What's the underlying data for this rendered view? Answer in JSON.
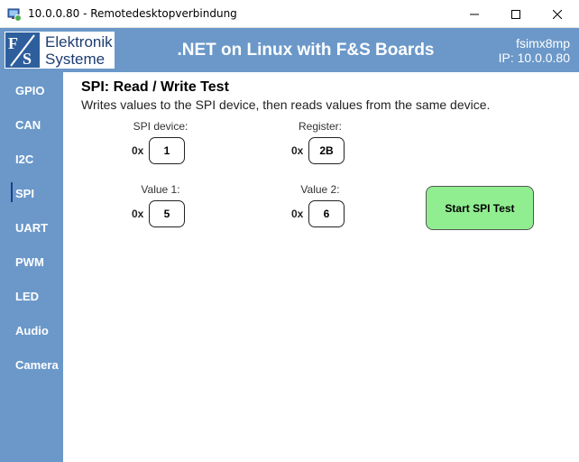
{
  "window": {
    "title": "10.0.0.80 - Remotedesktopverbindung",
    "icon": "remote-desktop-icon"
  },
  "header": {
    "logo_line1": "Elektronik",
    "logo_line2": "Systeme",
    "title": ".NET on Linux with F&S Boards",
    "device": "fsimx8mp",
    "ip": "IP: 10.0.0.80"
  },
  "sidebar": {
    "active": "SPI",
    "items": [
      {
        "label": "GPIO"
      },
      {
        "label": "CAN"
      },
      {
        "label": "I2C"
      },
      {
        "label": "SPI"
      },
      {
        "label": "UART"
      },
      {
        "label": "PWM"
      },
      {
        "label": "LED"
      },
      {
        "label": "Audio"
      },
      {
        "label": "Camera"
      }
    ]
  },
  "main": {
    "title": "SPI: Read / Write Test",
    "description": "Writes values to the SPI device, then reads values from the same device.",
    "fields": {
      "spi_device": {
        "label": "SPI device:",
        "prefix": "0x",
        "value": "1"
      },
      "register": {
        "label": "Register:",
        "prefix": "0x",
        "value": "2B"
      },
      "value1": {
        "label": "Value 1:",
        "prefix": "0x",
        "value": "5"
      },
      "value2": {
        "label": "Value 2:",
        "prefix": "0x",
        "value": "6"
      }
    },
    "start_button": "Start SPI Test"
  },
  "colors": {
    "accent_blue": "#6b98c9",
    "button_green": "#90ee90",
    "active_indicator": "#1a3e8c"
  }
}
